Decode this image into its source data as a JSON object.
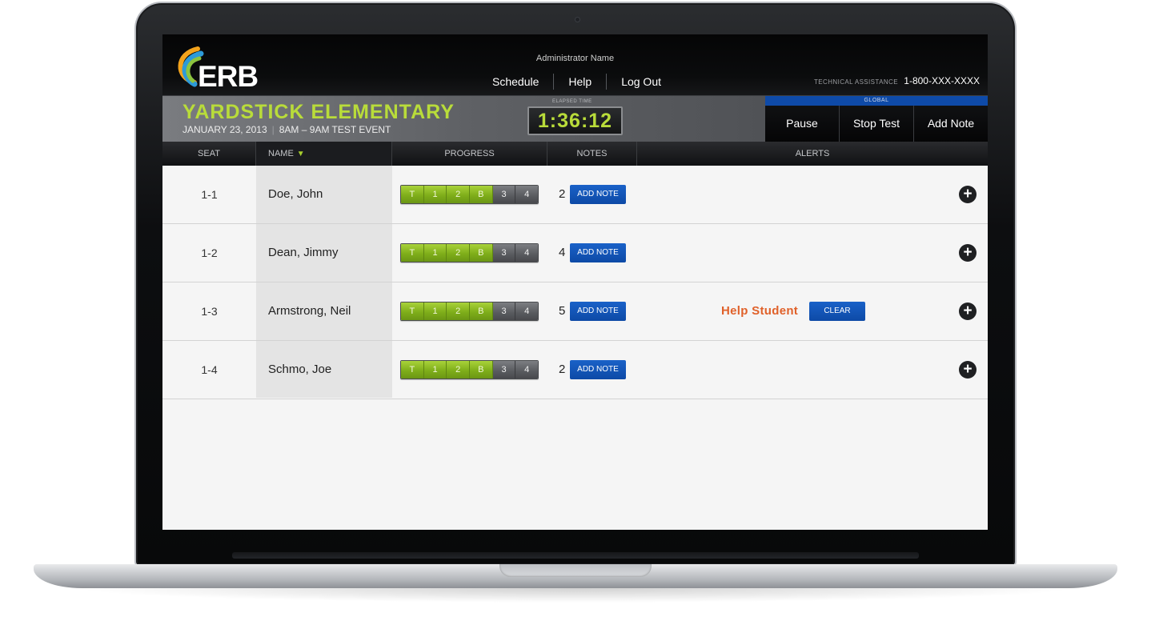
{
  "header": {
    "logo_text": "ERB",
    "admin_name": "Administrator Name",
    "nav": [
      {
        "label": "Schedule"
      },
      {
        "label": "Help"
      },
      {
        "label": "Log Out"
      }
    ],
    "tech_label": "Technical Assistance",
    "tech_phone": "1-800-XXX-XXXX"
  },
  "event": {
    "school": "YARDSTICK ELEMENTARY",
    "date": "JANUARY 23, 2013",
    "time": "8AM – 9AM TEST EVENT",
    "elapsed_label": "Elapsed Time",
    "elapsed": "1:36:12",
    "global_label": "Global",
    "global_buttons": [
      {
        "label": "Pause"
      },
      {
        "label": "Stop Test"
      },
      {
        "label": "Add Note"
      }
    ]
  },
  "table": {
    "columns": {
      "seat": "SEAT",
      "name": "NAME",
      "sort_icon": "sort-desc-triangle",
      "progress": "PROGRESS",
      "notes": "NOTES",
      "alerts": "ALERTS"
    },
    "segments": [
      "T",
      "1",
      "2",
      "B",
      "3",
      "4"
    ],
    "add_note_label": "ADD NOTE",
    "clear_label": "CLEAR",
    "rows": [
      {
        "seat": "1-1",
        "name": "Doe, John",
        "completed_segments": 4,
        "notes": "2",
        "alert": ""
      },
      {
        "seat": "1-2",
        "name": "Dean, Jimmy",
        "completed_segments": 4,
        "notes": "4",
        "alert": ""
      },
      {
        "seat": "1-3",
        "name": "Armstrong, Neil",
        "completed_segments": 4,
        "notes": "5",
        "alert": "Help Student"
      },
      {
        "seat": "1-4",
        "name": "Schmo, Joe",
        "completed_segments": 4,
        "notes": "2",
        "alert": ""
      }
    ]
  },
  "colors": {
    "accent_green": "#b9dc3a",
    "button_blue": "#0d4aa6",
    "alert_orange": "#e0612a"
  }
}
